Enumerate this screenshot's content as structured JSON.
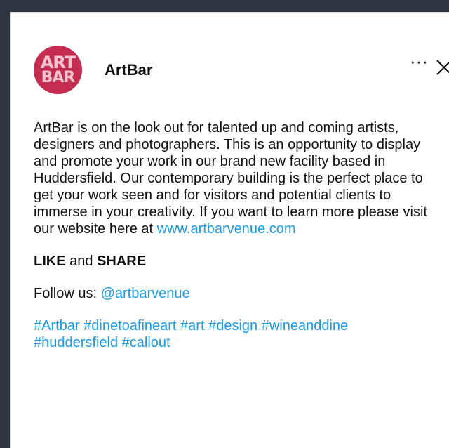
{
  "post": {
    "author": "ArtBar",
    "avatar_text_line1": "ART",
    "avatar_text_line2": "BAR",
    "more_icon": "more-horizontal-icon",
    "more_glyph": "···",
    "close_icon": "close-icon",
    "description": "ArtBar is on the look out for talented up and coming artists, designers and photographers. This is an opportunity to display and promote your work in our brand new facility based in Huddersfield. Our contemporary building is the perfect place to get your work seen and for visitors and potential clients to immerse in your creativity. If you want to learn more please visit our website here at ",
    "website_link": "www.artbarvenue.com",
    "cta_like": "LIKE",
    "cta_and": " and ",
    "cta_share": "SHARE",
    "follow_label": "Follow us: ",
    "follow_handle": "@artbarvenue",
    "hashtags": [
      "#Artbar",
      "#dinetoafineart",
      "#art",
      "#design",
      "#wineanddine",
      "#huddersfield",
      "#callout"
    ]
  },
  "colors": {
    "backdrop": "#2f3441",
    "link": "#1a9be8",
    "avatar_bg": "#c42c50",
    "avatar_text": "#f6c3d1"
  }
}
